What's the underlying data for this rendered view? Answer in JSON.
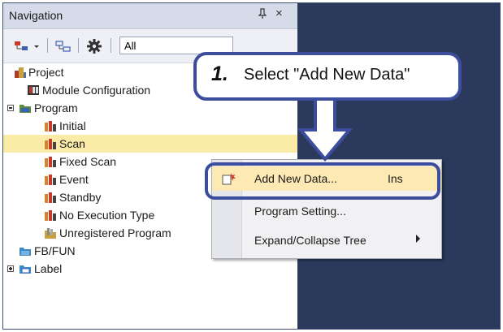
{
  "panel": {
    "title": "Navigation",
    "pin_icon": "pin-icon",
    "close_glyph": "×"
  },
  "toolbar": {
    "filter_value": "All"
  },
  "tree": {
    "items": [
      {
        "label": "Project",
        "icon": "project-icon"
      },
      {
        "label": "Module Configuration",
        "icon": "module-config-icon"
      },
      {
        "label": "Program",
        "icon": "program-folder-icon"
      },
      {
        "label": "Initial",
        "icon": "program-icon"
      },
      {
        "label": "Scan",
        "icon": "program-icon"
      },
      {
        "label": "Fixed Scan",
        "icon": "program-icon"
      },
      {
        "label": "Event",
        "icon": "program-icon"
      },
      {
        "label": "Standby",
        "icon": "program-icon"
      },
      {
        "label": "No Execution Type",
        "icon": "program-icon"
      },
      {
        "label": "Unregistered Program",
        "icon": "unregistered-program-icon"
      },
      {
        "label": "FB/FUN",
        "icon": "fbfun-folder-icon"
      },
      {
        "label": "Label",
        "icon": "label-folder-icon"
      }
    ]
  },
  "context_menu": {
    "items": [
      {
        "label": "Add New Data...",
        "shortcut": "Ins"
      },
      {
        "label": "Program Setting..."
      },
      {
        "label": "Expand/Collapse Tree"
      }
    ]
  },
  "callout": {
    "step_number": "1.",
    "text": "Select \"Add New Data\""
  },
  "colors": {
    "accent": "#3c4d9c",
    "selection": "#fbeba9",
    "menu_highlight": "#fde9b4",
    "background_area": "#2b3a5c"
  }
}
